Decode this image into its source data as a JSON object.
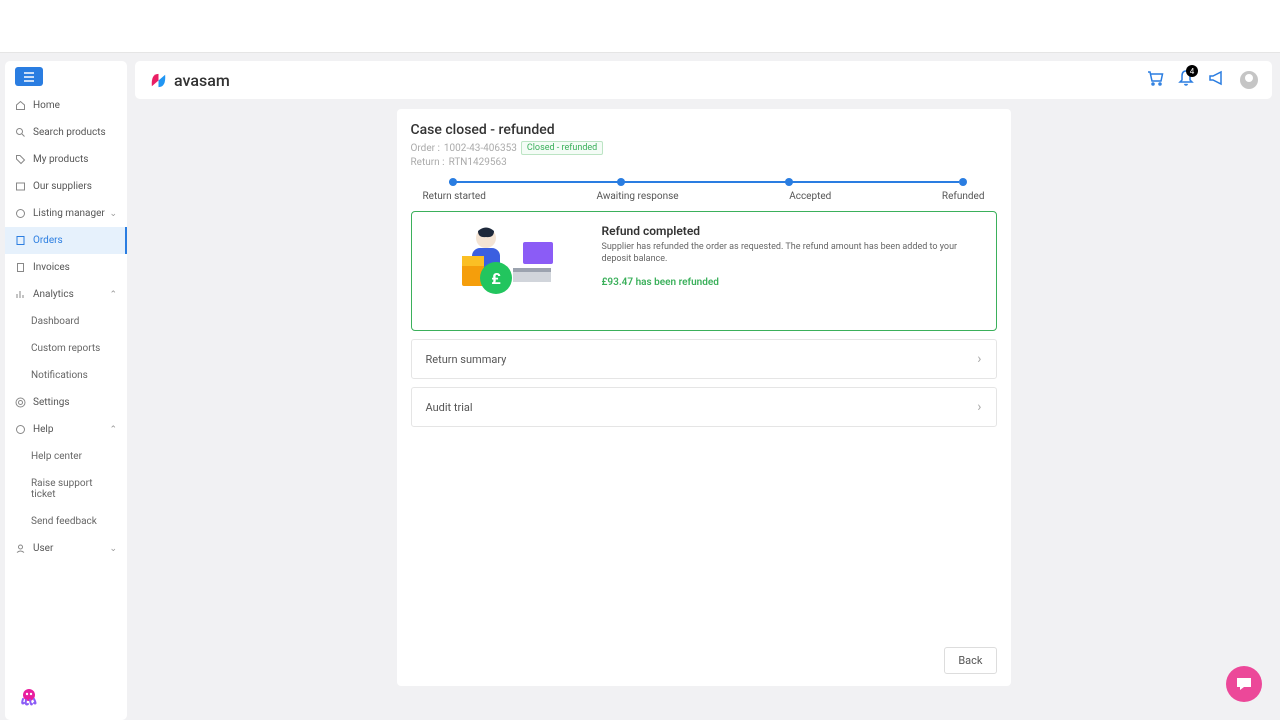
{
  "header": {
    "brand": "avasam",
    "notification_count": "4"
  },
  "sidebar": {
    "items": {
      "home": "Home",
      "search": "Search products",
      "myprod": "My products",
      "suppliers": "Our suppliers",
      "listing": "Listing manager",
      "orders": "Orders",
      "invoices": "Invoices",
      "analytics": "Analytics",
      "settings": "Settings",
      "help": "Help",
      "user": "User"
    },
    "analytics_sub": {
      "dash": "Dashboard",
      "custom": "Custom reports",
      "notif": "Notifications"
    },
    "help_sub": {
      "center": "Help center",
      "ticket": "Raise support ticket",
      "feedback": "Send feedback"
    }
  },
  "case": {
    "title": "Case closed - refunded",
    "order_label": "Order :",
    "order_num": "1002-43-406353",
    "status_badge": "Closed - refunded",
    "return_label": "Return :",
    "return_num": "RTN1429563",
    "steps": {
      "s1": "Return started",
      "s2": "Awaiting response",
      "s3": "Accepted",
      "s4": "Refunded"
    },
    "refund": {
      "title": "Refund completed",
      "desc": "Supplier has refunded the order as requested. The refund amount has been added to your deposit balance.",
      "amount": "£93.47 has been refunded"
    },
    "accordions": {
      "summary": "Return summary",
      "audit": "Audit trial"
    },
    "back": "Back"
  }
}
